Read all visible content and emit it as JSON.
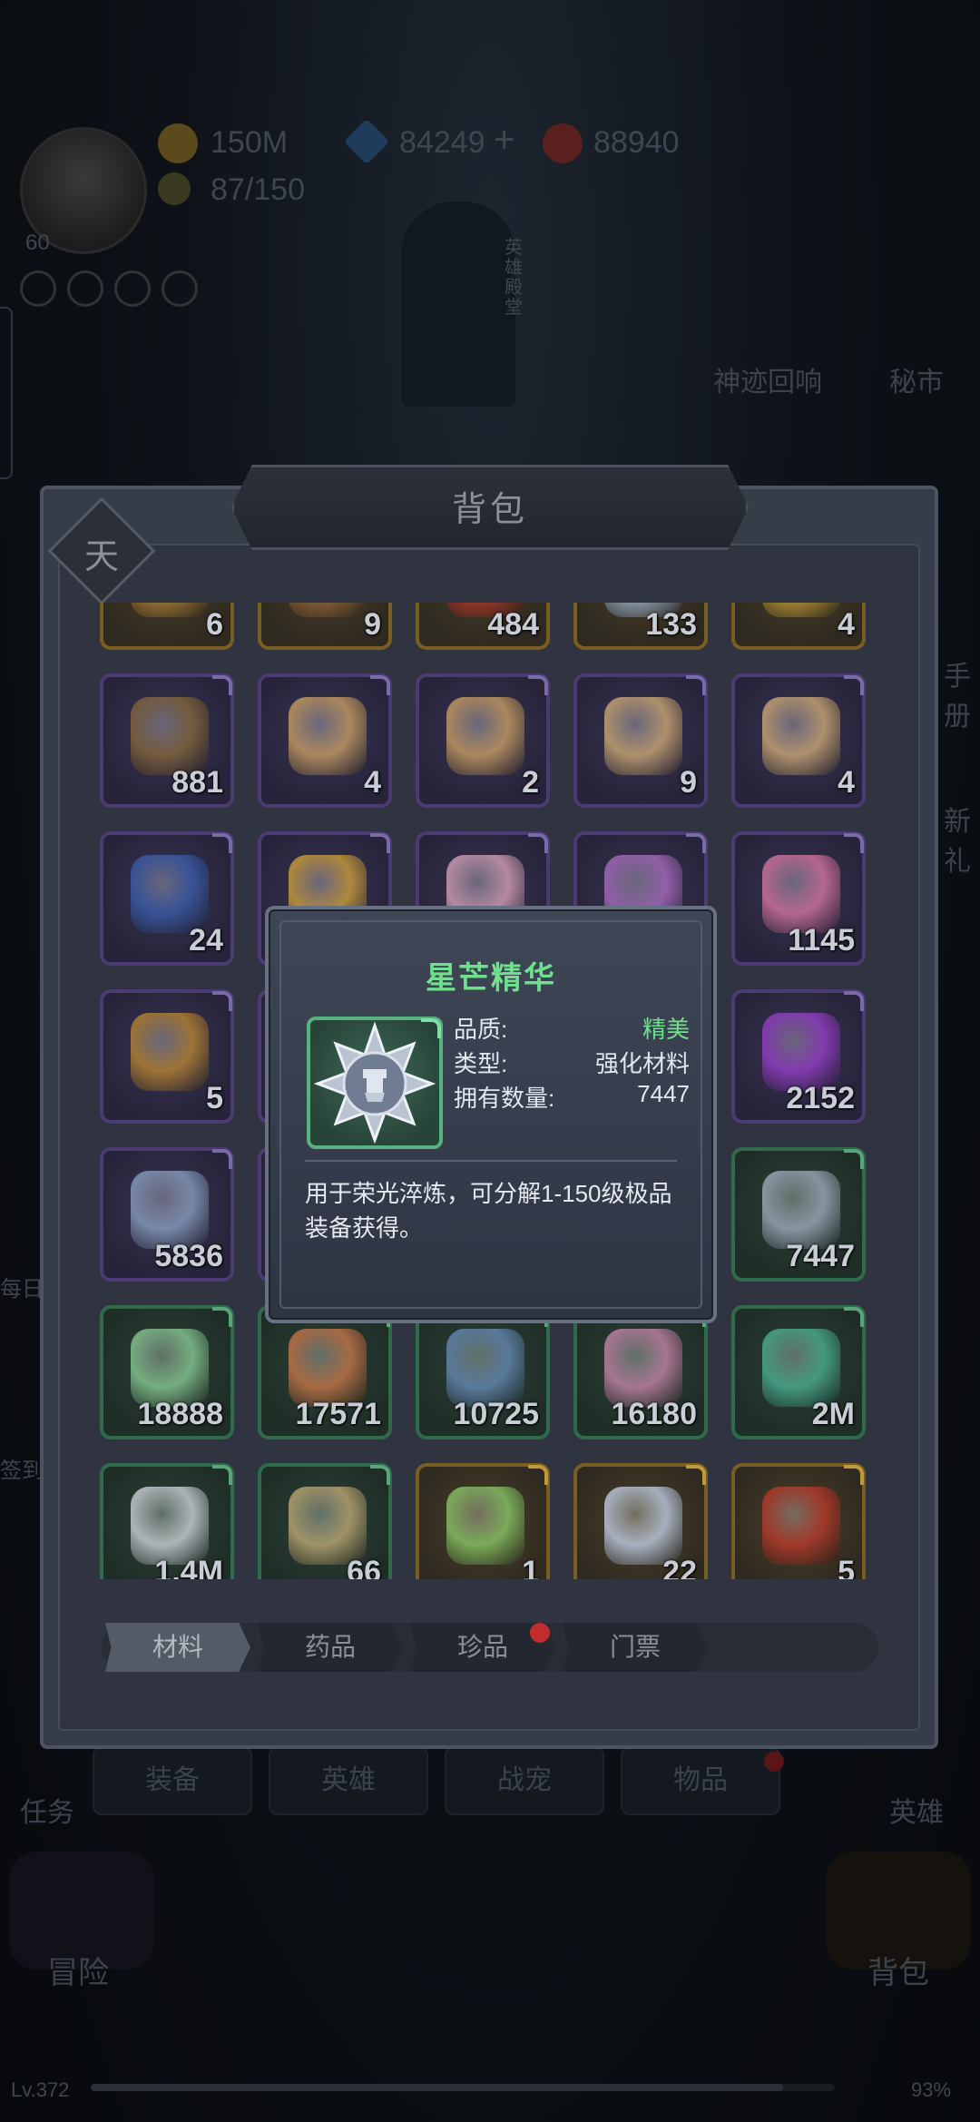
{
  "hud": {
    "level": "60",
    "gold": "150M",
    "diamond": "84249",
    "ruby": "88940",
    "energy": "87/150",
    "vertical_label": "英雄殿堂"
  },
  "side_menu": {
    "echo": "神迹回响",
    "secret": "秘市",
    "right1": "手册",
    "right2": "新礼",
    "left1": "每日",
    "left2": "签到",
    "task": "任务",
    "hero": "英雄",
    "adventure": "冒险",
    "backpack": "背包"
  },
  "bottom_tabs": [
    {
      "label": "装备"
    },
    {
      "label": "英雄"
    },
    {
      "label": "战宠"
    },
    {
      "label": "物品"
    }
  ],
  "footer": {
    "level": "Lv.372",
    "percent": "93%",
    "progress": 0.93
  },
  "panel": {
    "title": "背包",
    "badge": "天"
  },
  "grid": {
    "rows": [
      [
        {
          "count": "6",
          "q": "gold",
          "c": "#b98a3c"
        },
        {
          "count": "9",
          "q": "gold",
          "c": "#a07040"
        },
        {
          "count": "484",
          "q": "gold",
          "c": "#c0392b"
        },
        {
          "count": "133",
          "q": "gold",
          "c": "#a9c3e0"
        },
        {
          "count": "4",
          "q": "gold",
          "c": "#d4a93a"
        }
      ],
      [
        {
          "count": "881",
          "q": "purple",
          "c": "#8a6a3a"
        },
        {
          "count": "4",
          "q": "purple",
          "c": "#d3a665"
        },
        {
          "count": "2",
          "q": "purple",
          "c": "#d3a665"
        },
        {
          "count": "9",
          "q": "purple",
          "c": "#d8b178"
        },
        {
          "count": "4",
          "q": "purple",
          "c": "#d8b178"
        }
      ],
      [
        {
          "count": "24",
          "q": "purple",
          "c": "#3a5fb0"
        },
        {
          "count": "",
          "q": "purple",
          "c": "#d8a63a"
        },
        {
          "count": "",
          "q": "purple",
          "c": "#e0a8c0"
        },
        {
          "count": "",
          "q": "purple",
          "c": "#b070c8"
        },
        {
          "count": "1145",
          "q": "purple",
          "c": "#e07aa6"
        }
      ],
      [
        {
          "count": "5",
          "q": "purple",
          "c": "#c08a30"
        },
        {
          "count": "",
          "q": "purple",
          "c": "#555"
        },
        {
          "count": "",
          "q": "purple",
          "c": "#555"
        },
        {
          "count": "",
          "q": "purple",
          "c": "#555"
        },
        {
          "count": "2152",
          "q": "purple",
          "c": "#9b3fd0"
        }
      ],
      [
        {
          "count": "5836",
          "q": "purple",
          "c": "#8ea6c8"
        },
        {
          "count": "",
          "q": "purple",
          "c": "#555"
        },
        {
          "count": "",
          "q": "purple",
          "c": "#555"
        },
        {
          "count": "",
          "q": "purple",
          "c": "#555"
        },
        {
          "count": "7447",
          "q": "green",
          "c": "#a7b3c6"
        }
      ],
      [
        {
          "count": "18888",
          "q": "green",
          "c": "#8fd39a"
        },
        {
          "count": "17571",
          "q": "green",
          "c": "#d27a4a"
        },
        {
          "count": "10725",
          "q": "green",
          "c": "#6a8fbf"
        },
        {
          "count": "16180",
          "q": "green",
          "c": "#d08ab0"
        },
        {
          "count": "2M",
          "q": "green",
          "c": "#4fb89a"
        }
      ],
      [
        {
          "count": "1.4M",
          "q": "green",
          "c": "#d8dde4"
        },
        {
          "count": "66",
          "q": "green",
          "c": "#c8b078"
        },
        {
          "count": "1",
          "q": "gold",
          "c": "#8ed06a"
        },
        {
          "count": "22",
          "q": "gold",
          "c": "#c8d8f0"
        },
        {
          "count": "5",
          "q": "gold",
          "c": "#c0392b"
        }
      ]
    ]
  },
  "tabs": [
    {
      "label": "材料",
      "active": true
    },
    {
      "label": "药品",
      "active": false
    },
    {
      "label": "珍品",
      "active": false
    },
    {
      "label": "门票",
      "active": false
    }
  ],
  "tooltip": {
    "name": "星芒精华",
    "quality_label": "品质:",
    "quality_value": "精美",
    "type_label": "类型:",
    "type_value": "强化材料",
    "owned_label": "拥有数量:",
    "owned_value": "7447",
    "description": "用于荣光淬炼，可分解1-150级极品装备获得。",
    "quality_color": "#6fe08c",
    "name_color": "#6fe08c"
  }
}
